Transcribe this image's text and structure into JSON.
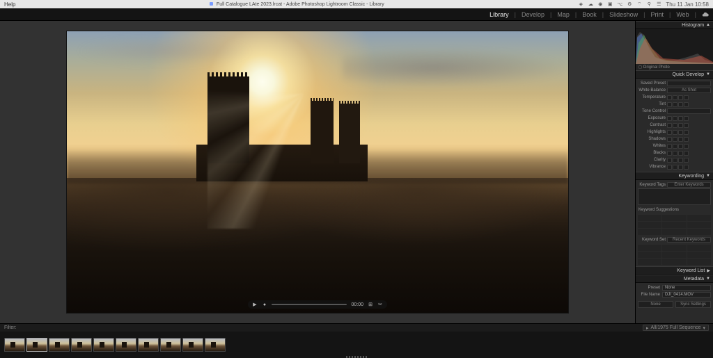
{
  "menubar": {
    "help": "Help",
    "title": "Full Catalogue LAte 2023.lrcat - Adobe Photoshop Lightroom Classic - Library",
    "clock": "Thu 11 Jan  10:58"
  },
  "modules": {
    "library": "Library",
    "develop": "Develop",
    "map": "Map",
    "book": "Book",
    "slideshow": "Slideshow",
    "print": "Print",
    "web": "Web"
  },
  "video": {
    "time": "00:00"
  },
  "histogram": {
    "header": "Histogram",
    "footer": "Original Photo"
  },
  "quickdev": {
    "header": "Quick Develop",
    "saved_preset_lbl": "Saved Preset",
    "saved_preset_val": "",
    "wb_lbl": "White Balance",
    "wb_val": "As Shot",
    "temp_lbl": "Temperature",
    "tint_lbl": "Tint",
    "tone_lbl": "Tone Control",
    "exposure_lbl": "Exposure",
    "contrast_lbl": "Contrast",
    "highlights_lbl": "Highlights",
    "shadows_lbl": "Shadows",
    "whites_lbl": "Whites",
    "blacks_lbl": "Blacks",
    "clarity_lbl": "Clarity",
    "vibrance_lbl": "Vibrance"
  },
  "keywording": {
    "header": "Keywording",
    "tags_lbl": "Keyword Tags",
    "tags_mode": "Enter Keywords",
    "sugg_lbl": "Keyword Suggestions",
    "set_lbl": "Keyword Set",
    "set_val": "Recent Keywords"
  },
  "keywordlist": {
    "header": "Keyword List"
  },
  "metadata": {
    "header": "Metadata",
    "preset_lbl": "Preset",
    "preset_val": "None",
    "filename_lbl": "File Name",
    "filename_val": "DJI_0414.MOV",
    "btn_cancel": "None",
    "btn_sync": "Sync Settings"
  },
  "filter": {
    "label": "Filter:",
    "source": "All/1975 Full Sequence"
  }
}
